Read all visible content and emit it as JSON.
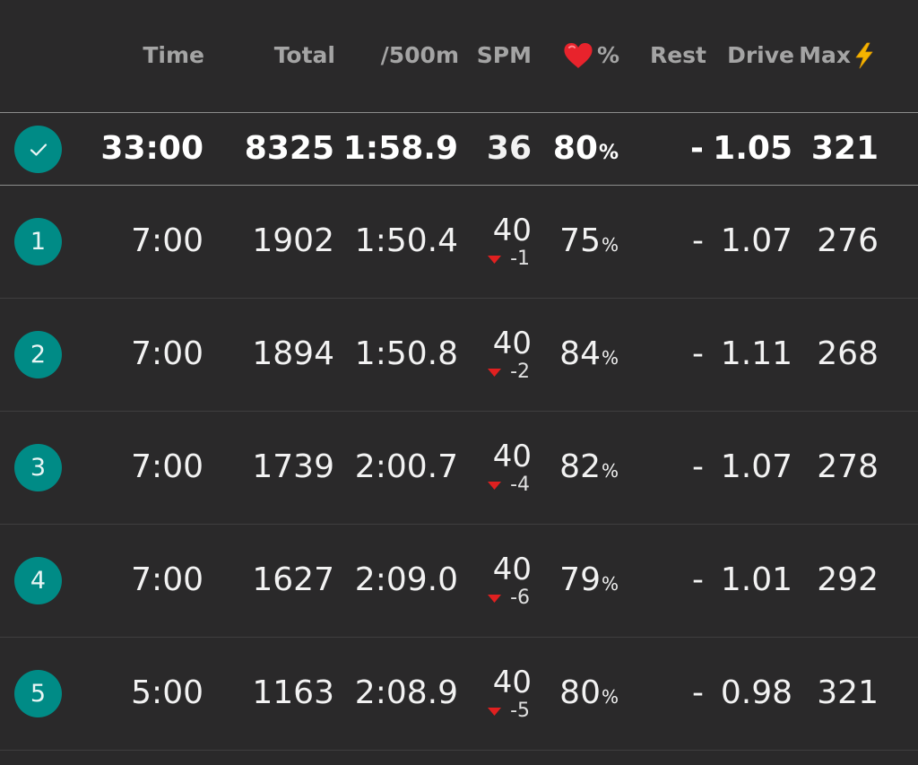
{
  "header": {
    "time": "Time",
    "total": "Total",
    "pace": "/500m",
    "spm": "SPM",
    "hr_pct": "%",
    "rest": "Rest",
    "drive": "Drive",
    "max": "Max",
    "heart_icon": "heart-icon",
    "bolt_icon": "lightning-bolt-icon"
  },
  "colors": {
    "background": "#2a292a",
    "badge": "#008b86",
    "header_text": "#a4a4a4",
    "down_arrow": "#e02020",
    "heart": "#e8232c",
    "bolt": "#f5b400"
  },
  "summary": {
    "badge_icon": "check-icon",
    "time": "33:00",
    "total": "8325",
    "pace": "1:58.9",
    "spm": "36",
    "hr": "80",
    "pct": "%",
    "rest": "-",
    "drive": "1.05",
    "max": "321"
  },
  "intervals": [
    {
      "index": "1",
      "time": "7:00",
      "total": "1902",
      "pace": "1:50.4",
      "spm": "40",
      "spm_delta": "-1",
      "hr": "75",
      "pct": "%",
      "rest": "-",
      "drive": "1.07",
      "max": "276"
    },
    {
      "index": "2",
      "time": "7:00",
      "total": "1894",
      "pace": "1:50.8",
      "spm": "40",
      "spm_delta": "-2",
      "hr": "84",
      "pct": "%",
      "rest": "-",
      "drive": "1.11",
      "max": "268"
    },
    {
      "index": "3",
      "time": "7:00",
      "total": "1739",
      "pace": "2:00.7",
      "spm": "40",
      "spm_delta": "-4",
      "hr": "82",
      "pct": "%",
      "rest": "-",
      "drive": "1.07",
      "max": "278"
    },
    {
      "index": "4",
      "time": "7:00",
      "total": "1627",
      "pace": "2:09.0",
      "spm": "40",
      "spm_delta": "-6",
      "hr": "79",
      "pct": "%",
      "rest": "-",
      "drive": "1.01",
      "max": "292"
    },
    {
      "index": "5",
      "time": "5:00",
      "total": "1163",
      "pace": "2:08.9",
      "spm": "40",
      "spm_delta": "-5",
      "hr": "80",
      "pct": "%",
      "rest": "-",
      "drive": "0.98",
      "max": "321"
    }
  ]
}
